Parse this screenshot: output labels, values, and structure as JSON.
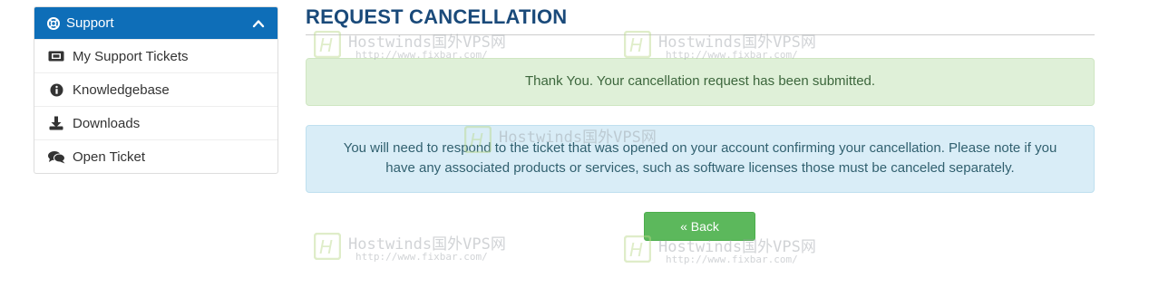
{
  "sidebar": {
    "header": {
      "label": "Support",
      "icon": "life-ring-icon",
      "chevron": "chevron-up-icon",
      "color": "#0e6eb8"
    },
    "items": [
      {
        "label": "My Support Tickets",
        "icon": "ticket-icon"
      },
      {
        "label": "Knowledgebase",
        "icon": "info-circle-icon"
      },
      {
        "label": "Downloads",
        "icon": "download-icon"
      },
      {
        "label": "Open Ticket",
        "icon": "comments-icon"
      }
    ]
  },
  "main": {
    "title": "REQUEST CANCELLATION",
    "success_message": "Thank You. Your cancellation request has been submitted.",
    "info_message": "You will need to respond to the ticket that was opened on your account confirming your cancellation. Please note if you have any associated products or services, such as software licenses those must be canceled separately.",
    "back_button": "« Back"
  },
  "watermark": {
    "title": "Hostwinds国外VPS网",
    "url": "http://www.fixbar.com/"
  },
  "colors": {
    "title": "#1a4a7a",
    "success_bg": "#dff0d8",
    "info_bg": "#d9edf7",
    "button": "#5cb85c"
  }
}
